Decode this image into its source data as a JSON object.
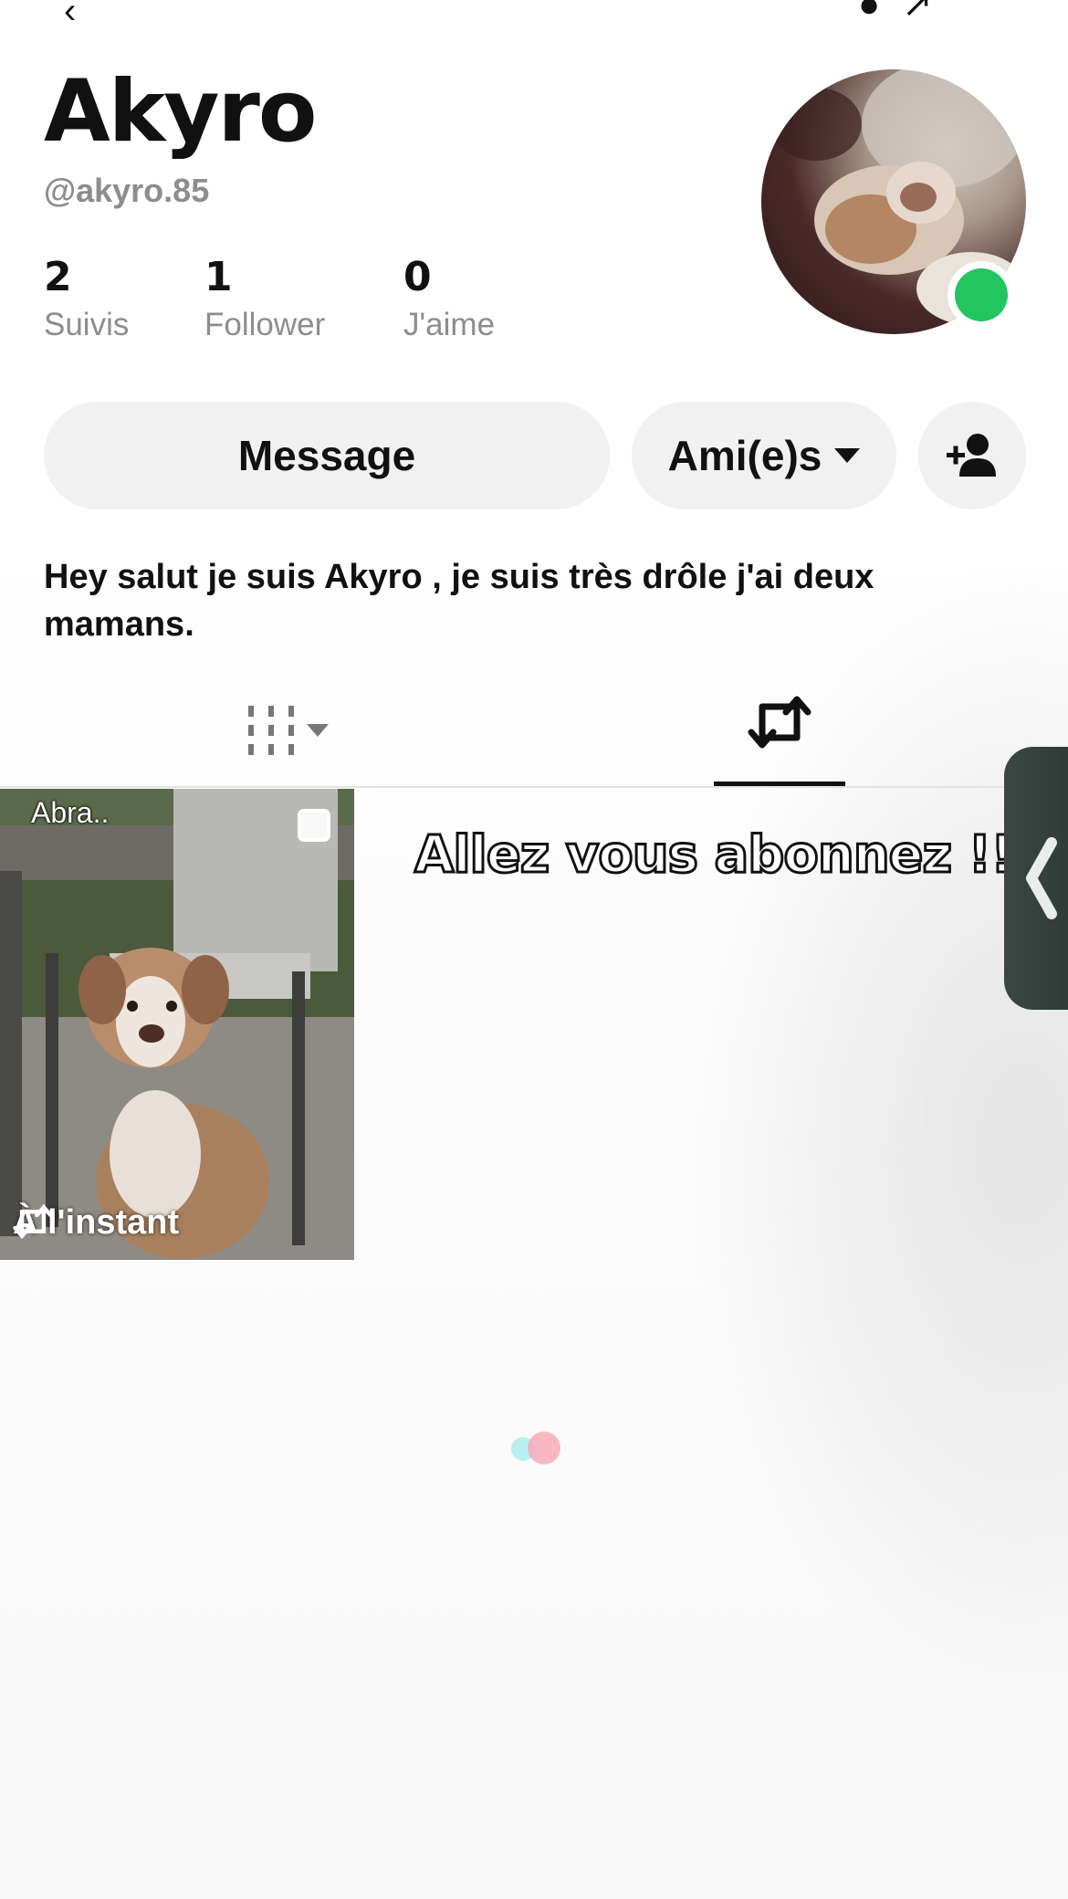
{
  "profile": {
    "display_name": "Akyro",
    "username": "@akyro.85",
    "bio": "Hey salut je suis Akyro , je suis très drôle j'ai deux mamans.",
    "online": true
  },
  "stats": [
    {
      "value": "2",
      "label": "Suivis"
    },
    {
      "value": "1",
      "label": "Follower"
    },
    {
      "value": "0",
      "label": "J'aime"
    }
  ],
  "actions": {
    "message_label": "Message",
    "friends_label": "Ami(e)s"
  },
  "tabs": {
    "active": "reposts"
  },
  "grid": {
    "items": [
      {
        "caption": "Abra..",
        "footer": "À l'instant"
      }
    ]
  },
  "overlay_text": "Allez vous abonnez !!",
  "colors": {
    "online": "#22c55e",
    "button_bg": "#f1f1f1",
    "muted_text": "#8d8d8d",
    "side_handle": "#2e3a36"
  }
}
